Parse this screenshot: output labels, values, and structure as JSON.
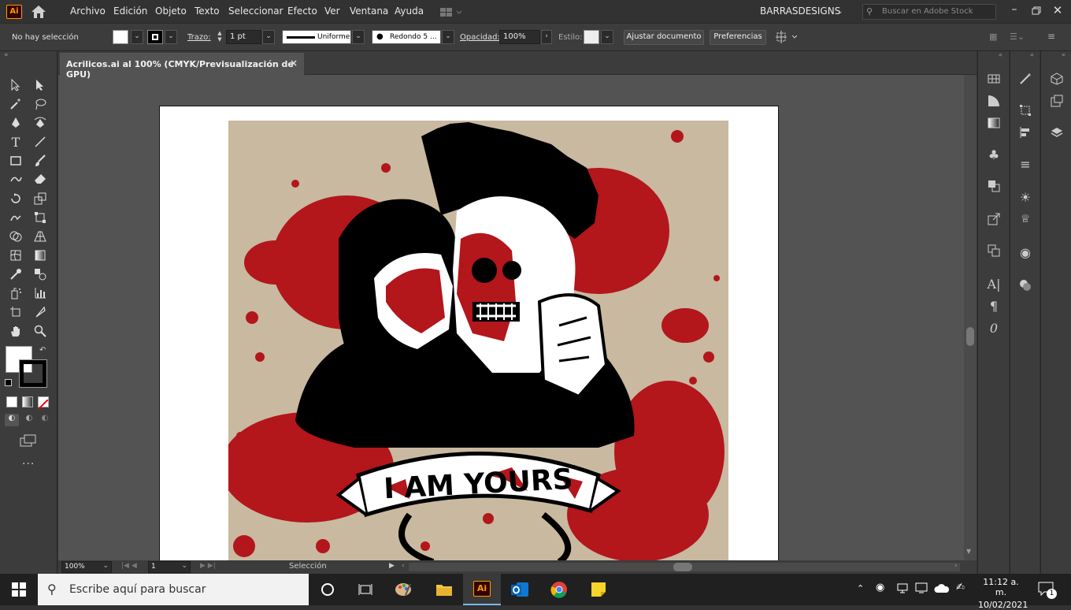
{
  "menubar": {
    "app_badge": "Ai",
    "menus": [
      "Archivo",
      "Edición",
      "Objeto",
      "Texto",
      "Seleccionar",
      "Efecto",
      "Ver",
      "Ventana",
      "Ayuda"
    ],
    "workspace": "BARRASDESIGNS",
    "stock_placeholder": "Buscar en Adobe Stock"
  },
  "control": {
    "selection": "No hay selección",
    "stroke_label": "Trazo:",
    "stroke_value": "1 pt",
    "profile": "Uniforme",
    "brush": "Redondo 5 ...",
    "opacity_label": "Opacidad:",
    "opacity_value": "100%",
    "style_label": "Estilo:",
    "doc_setup": "Ajustar documento",
    "prefs": "Preferencias"
  },
  "document": {
    "tab_title": "Acrilicos.ai al 100% (CMYK/Previsualización de GPU)",
    "close": "×",
    "art_text": "I AM YOURS"
  },
  "status": {
    "zoom": "100%",
    "artboard_num": "1",
    "tool": "Selección"
  },
  "taskbar": {
    "search_placeholder": "Escribe aquí para buscar",
    "time": "11:12 a. m.",
    "date": "10/02/2021",
    "notif_count": "1",
    "ai_badge": "Ai"
  },
  "colors": {
    "accent": "#ff9a00",
    "blood": "#b3161b",
    "beige": "#c8b9a0"
  }
}
